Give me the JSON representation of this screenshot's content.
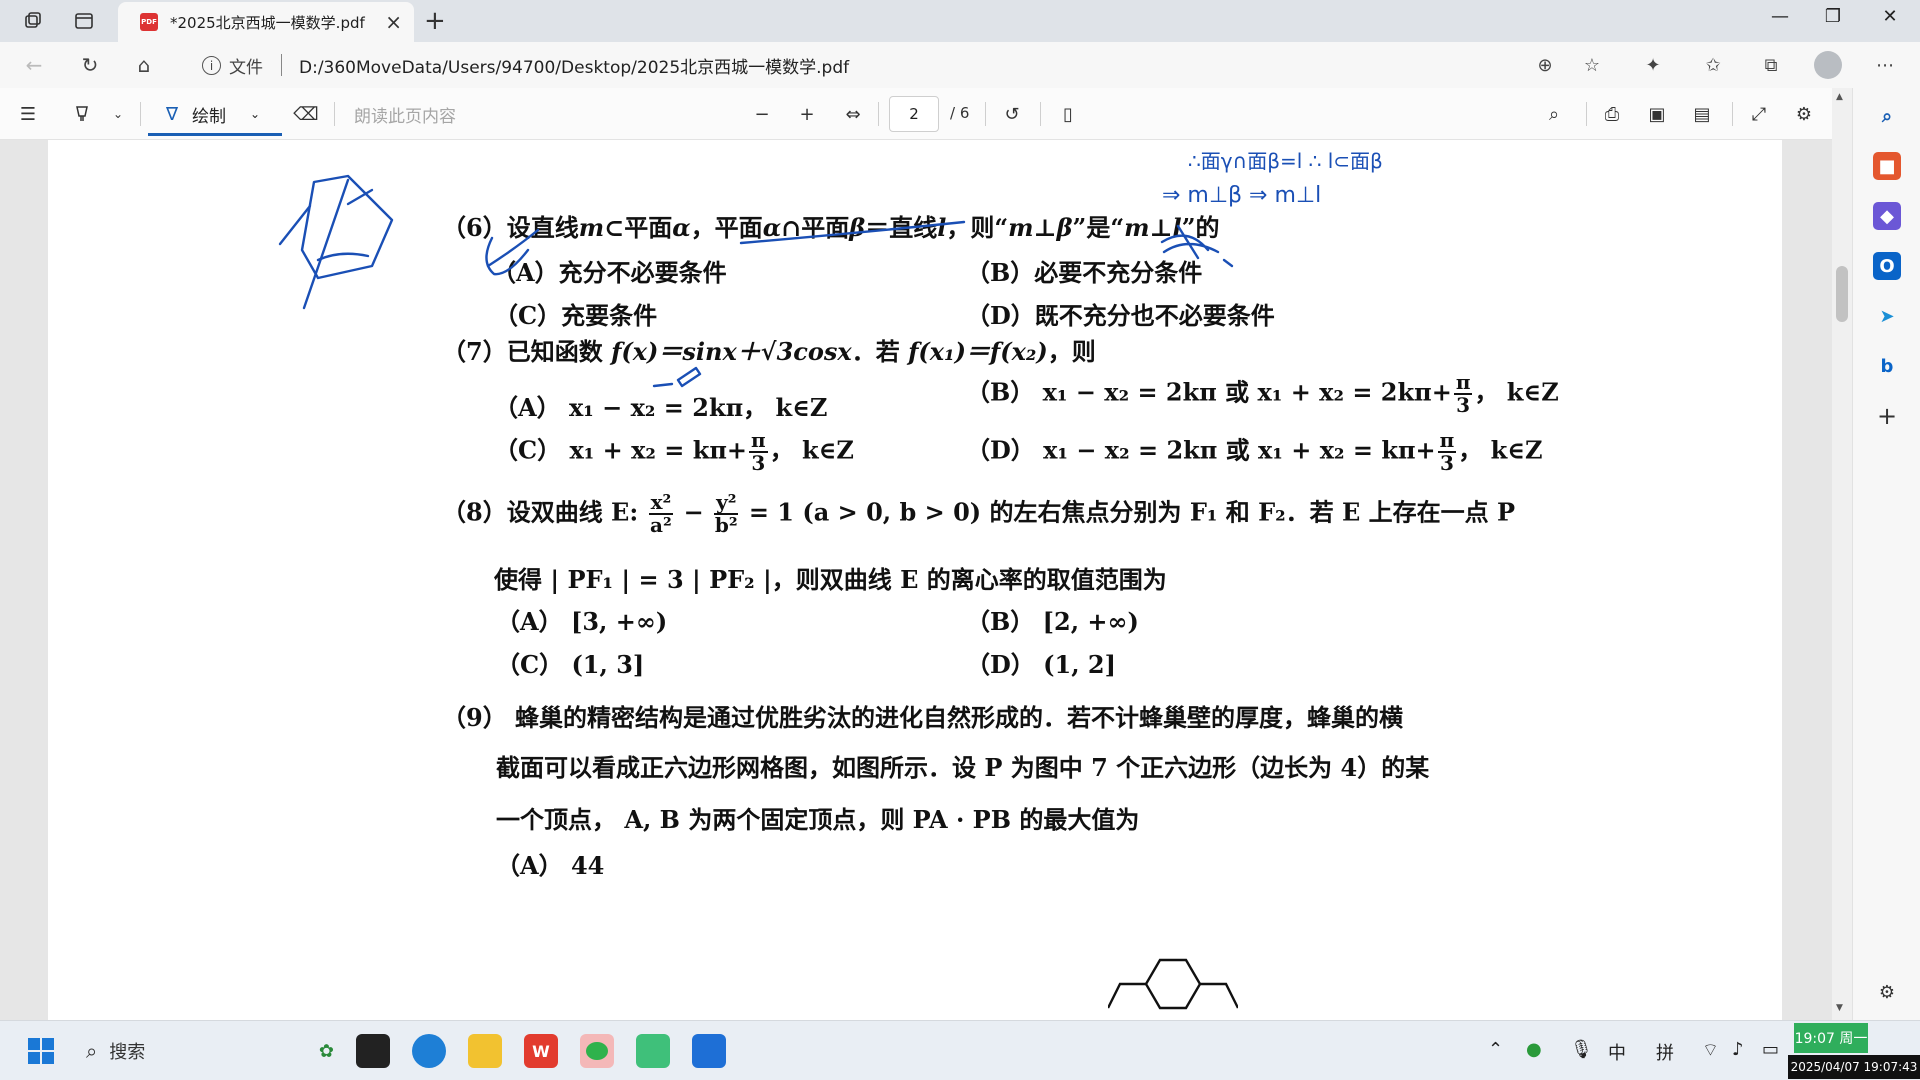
{
  "browser": {
    "tab_title": "*2025北京西城一模数学.pdf",
    "pdf_badge": "PDF",
    "address_label": "文件",
    "url": "D:/360MoveData/Users/94700/Desktop/2025北京西城一模数学.pdf"
  },
  "pdf_toolbar": {
    "draw_label": "绘制",
    "read_aloud_label": "朗读此页内容",
    "current_page": "2",
    "page_count": "/ 6"
  },
  "document": {
    "q6": {
      "stem": [
        "（6）设直线",
        "m",
        "⊂平面",
        "α",
        "，平面",
        "α",
        "∩平面",
        "β",
        "＝直线",
        "l",
        "，则“",
        "m⊥β",
        "”是“",
        "m⊥l",
        "”的"
      ],
      "options": {
        "A": "（A）充分不必要条件",
        "B": "（B）必要不充分条件",
        "C": "（C）充要条件",
        "D": "（D）既不充分也不必要条件"
      }
    },
    "q7": {
      "stem_prefix": "（7）已知函数 ",
      "stem_func": "f(x)＝sinx＋√3cosx",
      "stem_mid": "．若 ",
      "stem_cond": "f(x₁)＝f(x₂)",
      "stem_suffix": "，则",
      "option_A": "（A） x₁ − x₂ = 2kπ，  k∈Z",
      "option_B_pre": "（B） x₁ − x₂ = 2kπ 或 x₁ + x₂ = 2kπ+",
      "option_B_post": "，  k∈Z",
      "option_C_pre": "（C） x₁ + x₂ = kπ+",
      "option_C_post": "，  k∈Z",
      "option_D_pre": "（D） x₁ − x₂ = 2kπ 或 x₁ + x₂ = kπ+",
      "option_D_post": "，  k∈Z",
      "frac_num": "π",
      "frac_den": "3"
    },
    "q8": {
      "stem_pre": "（8）设双曲线 E: ",
      "frac1_num": "x²",
      "frac1_den": "a²",
      "minus": " − ",
      "frac2_num": "y²",
      "frac2_den": "b²",
      "stem_post": " = 1 (a > 0, b > 0) 的左右焦点分别为 F₁ 和 F₂．若 E 上存在一点 P",
      "line2": "使得 | PF₁ | = 3 | PF₂ |，则双曲线 E 的离心率的取值范围为",
      "option_A": "（A） [3, +∞)",
      "option_B": "（B） [2, +∞)",
      "option_C": "（C） (1, 3]",
      "option_D": "（D） (1, 2]"
    },
    "q9": {
      "line1": "（9） 蜂巢的精密结构是通过优胜劣汰的进化自然形成的．若不计蜂巢壁的厚度，蜂巢的横",
      "line2": "截面可以看成正六边形网格图，如图所示．设 P 为图中 7 个正六边形（边长为 4）的某",
      "line3": "一个顶点， A, B 为两个固定顶点，则 PA · PB 的最大值为",
      "option_A": "（A） 44"
    }
  },
  "handwriting": {
    "note_line1": "∴面γ∩面β=l    ∴ l⊂面β",
    "note_line2": "⇒    m⊥β ⇒ m⊥l",
    "ink_color": "#1a4fb5"
  },
  "taskbar": {
    "search_placeholder": "搜索",
    "ime_lang": "中",
    "ime_mode": "拼",
    "clock_time": "19:07 周一",
    "clock_datetime": "2025/04/07 19:07:43"
  }
}
